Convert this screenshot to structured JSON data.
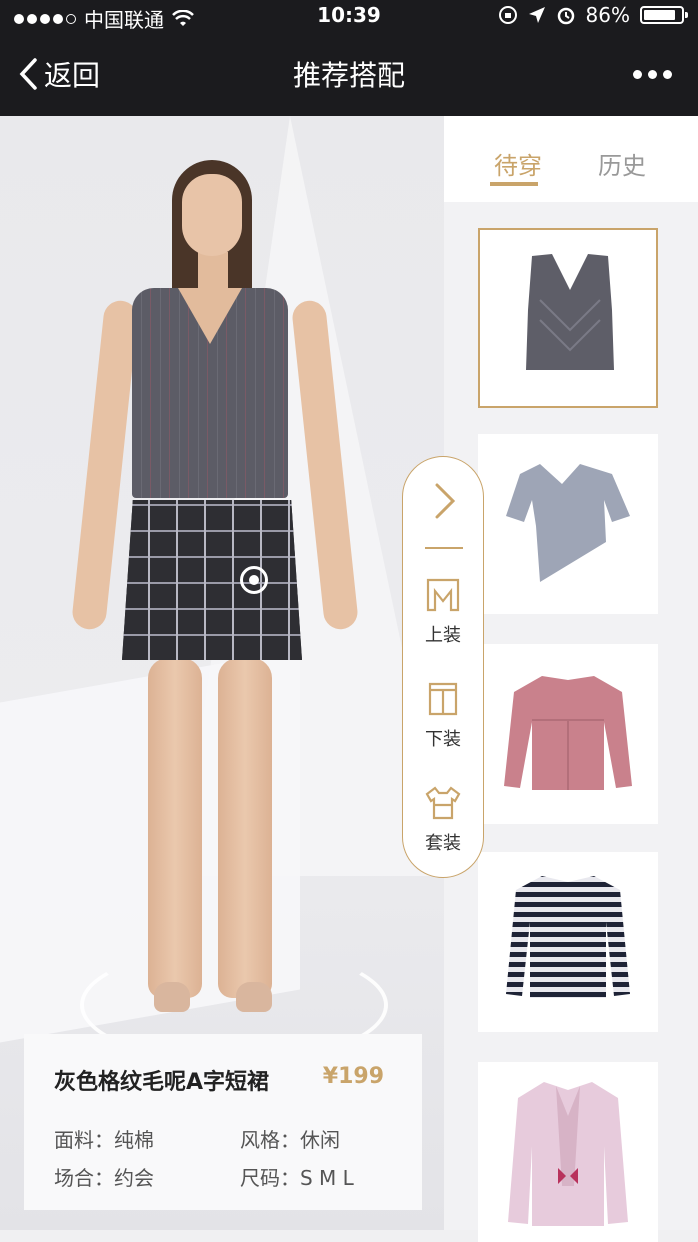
{
  "status_bar": {
    "carrier": "中国联通",
    "time": "10:39",
    "battery_pct": "86%",
    "battery_level": 0.86
  },
  "nav": {
    "back_label": "返回",
    "title": "推荐搭配"
  },
  "side_menu": {
    "items": [
      {
        "label": "上装",
        "icon": "top-garment-icon"
      },
      {
        "label": "下装",
        "icon": "bottom-garment-icon"
      },
      {
        "label": "套装",
        "icon": "outfit-set-icon"
      }
    ]
  },
  "product": {
    "name": "灰色格纹毛呢A字短裙",
    "price": "¥199",
    "fabric": "面料：纯棉",
    "style": "风格：休闲",
    "occasion": "场合：约会",
    "sizes": "尺码：S  M  L"
  },
  "tabs": [
    {
      "label": "待穿",
      "active": true
    },
    {
      "label": "历史",
      "active": false
    }
  ],
  "wardrobe": [
    {
      "item": "grey-v-neck-sleeveless-top",
      "selected": true
    },
    {
      "item": "grey-short-sleeve-asymmetric-top",
      "selected": false
    },
    {
      "item": "pink-suede-long-sleeve-top",
      "selected": false
    },
    {
      "item": "navy-white-striped-sweater",
      "selected": false
    },
    {
      "item": "pink-shirt-with-scarf",
      "selected": false
    }
  ],
  "colors": {
    "accent_gold": "#c9a46a",
    "nav_bg": "#1b1b1e"
  }
}
